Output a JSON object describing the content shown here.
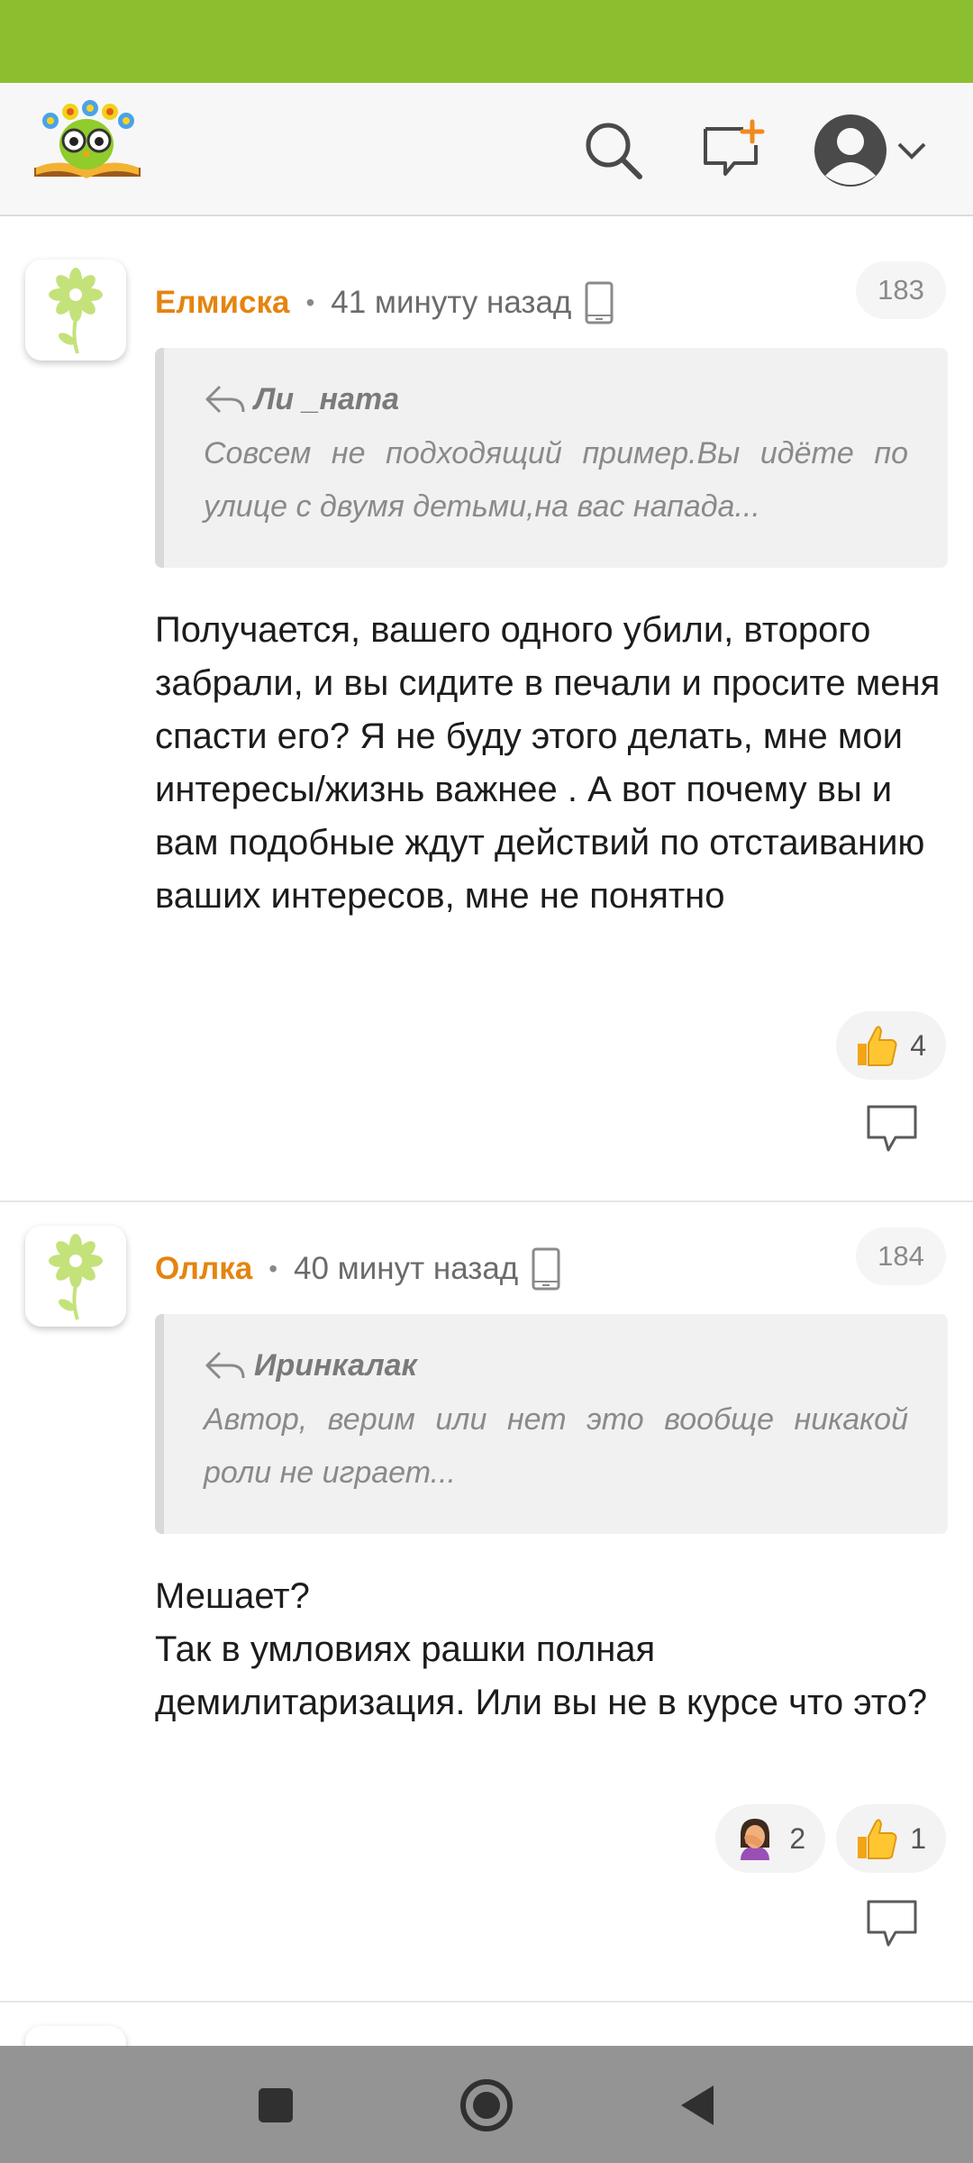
{
  "colors": {
    "status_bar": "#8cbf2f",
    "author": "#e5840f",
    "nav_bar": "#949494"
  },
  "header": {
    "logo_icon": "reading-owl-logo",
    "search_icon": "search-icon",
    "compose_icon": "new-comment-icon",
    "profile_icon": "avatar-icon"
  },
  "comments": [
    {
      "author": "Елмиска",
      "time": "41 минуту назад",
      "device_icon": "phone-icon",
      "number": "183",
      "quote_author": "Ли _ната",
      "quote_text": "Совсем не подходящий пример.Вы идёте по улице с двумя детьми,на вас напада...",
      "text": "Получается, вашего одного убили, второго забрали, и вы сидите в печали и просите меня спасти его? Я не буду этого делать, мне мои интересы/жизнь важнее . А вот почему вы и вам подобные ждут действий по отстаиванию ваших интересов, мне не понятно",
      "reactions": [
        {
          "icon": "thumbs-up-icon",
          "count": "4"
        }
      ]
    },
    {
      "author": "Оллка",
      "time": "40 минут назад",
      "device_icon": "phone-icon",
      "number": "184",
      "quote_author": "Иринкалак",
      "quote_text": "Автор, верим или нет это вообще никакой роли не играет...",
      "text_lines": [
        "Мешает?",
        "Так в умловиях рашки полная демилитаризация. Или вы не в курсе что это?"
      ],
      "reactions": [
        {
          "icon": "facepalm-icon",
          "count": "2"
        },
        {
          "icon": "thumbs-up-icon",
          "count": "1"
        }
      ]
    }
  ],
  "nav": {
    "recents": "square-icon",
    "home": "circle-icon",
    "back": "triangle-back-icon"
  }
}
